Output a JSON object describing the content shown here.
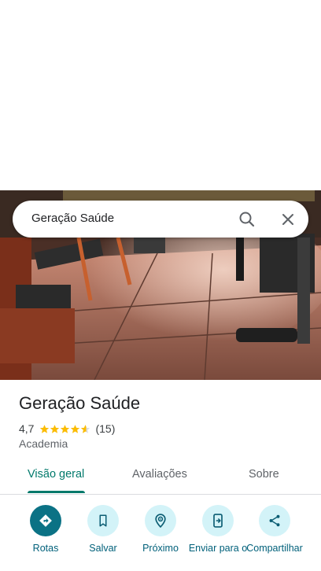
{
  "search": {
    "query": "Geração Saúde"
  },
  "place": {
    "name": "Geração Saúde",
    "rating": "4,7",
    "stars_value": 4.7,
    "reviews_count": "(15)",
    "category": "Academia"
  },
  "tabs": [
    {
      "label": "Visão geral",
      "active": true
    },
    {
      "label": "Avaliações",
      "active": false
    },
    {
      "label": "Sobre",
      "active": false
    }
  ],
  "actions": [
    {
      "label": "Rotas",
      "icon": "directions-icon"
    },
    {
      "label": "Salvar",
      "icon": "bookmark-icon"
    },
    {
      "label": "Próximo",
      "icon": "nearby-icon"
    },
    {
      "label": "Enviar para o",
      "icon": "send-to-phone-icon"
    },
    {
      "label": "Compartilhar",
      "icon": "share-icon"
    }
  ],
  "colors": {
    "accent": "#00796b",
    "primary_button": "#0b7285",
    "star": "#fbbc04",
    "button_bg": "#d3f3f8"
  }
}
